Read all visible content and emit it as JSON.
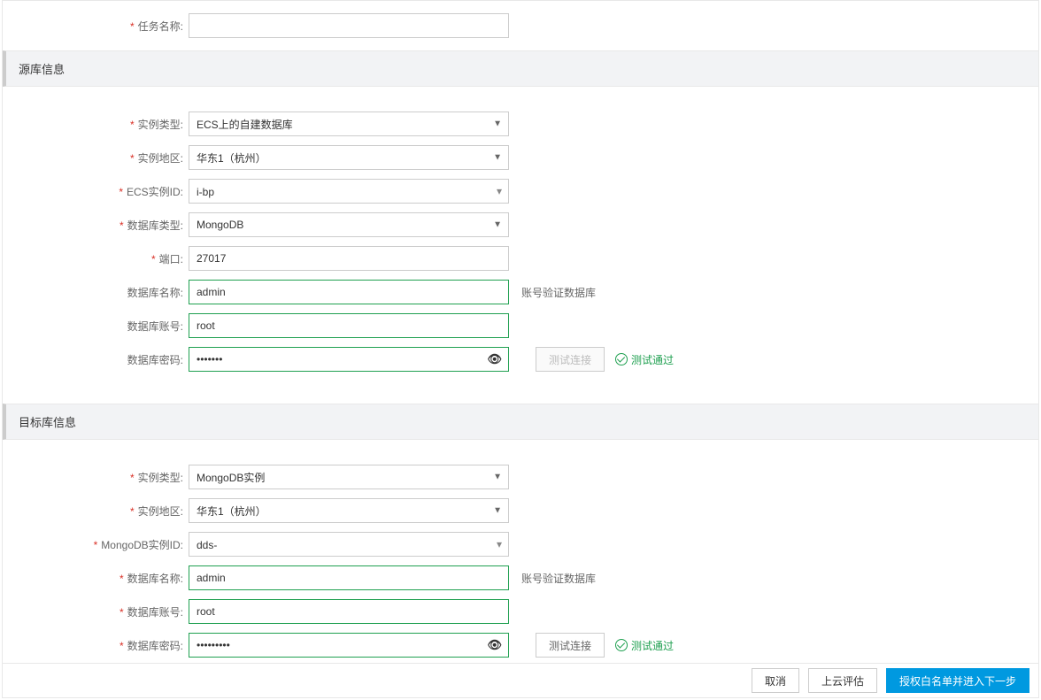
{
  "top": {
    "task_name_label": "任务名称:",
    "task_name_value": "　　　　　"
  },
  "source": {
    "header": "源库信息",
    "instance_type_label": "实例类型:",
    "instance_type_value": "ECS上的自建数据库",
    "instance_region_label": "实例地区:",
    "instance_region_value": "华东1（杭州）",
    "ecs_id_label": "ECS实例ID:",
    "ecs_id_value": "i-bp　　　　　　　　",
    "db_type_label": "数据库类型:",
    "db_type_value": "MongoDB",
    "port_label": "端口:",
    "port_value": "27017",
    "db_name_label": "数据库名称:",
    "db_name_value": "admin",
    "db_name_hint": "账号验证数据库",
    "db_user_label": "数据库账号:",
    "db_user_value": "root",
    "db_pass_label": "数据库密码:",
    "db_pass_value": "•••••••",
    "test_btn_label": "测试连接",
    "test_result_label": "测试通过"
  },
  "target": {
    "header": "目标库信息",
    "instance_type_label": "实例类型:",
    "instance_type_value": "MongoDB实例",
    "instance_region_label": "实例地区:",
    "instance_region_value": "华东1（杭州）",
    "mongo_id_label": "MongoDB实例ID:",
    "mongo_id_value": "dds-　　　　　　　　",
    "db_name_label": "数据库名称:",
    "db_name_value": "admin",
    "db_name_hint": "账号验证数据库",
    "db_user_label": "数据库账号:",
    "db_user_value": "root",
    "db_pass_label": "数据库密码:",
    "db_pass_value": "•••••••••",
    "test_btn_label": "测试连接",
    "test_result_label": "测试通过"
  },
  "footer": {
    "cancel": "取消",
    "cloud_eval": "上云评估",
    "next": "授权白名单并进入下一步"
  }
}
